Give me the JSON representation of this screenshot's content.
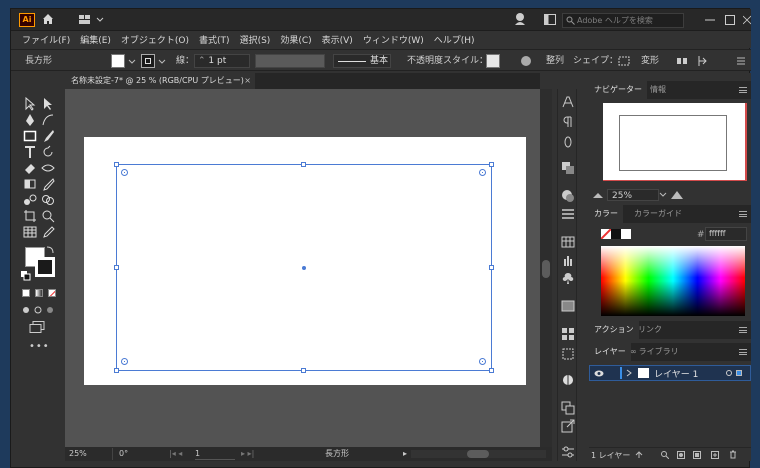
{
  "app": {
    "logo": "Ai",
    "search_placeholder": "Adobe ヘルプを検索"
  },
  "menu": [
    "ファイル(F)",
    "編集(E)",
    "オブジェクト(O)",
    "書式(T)",
    "選択(S)",
    "効果(C)",
    "表示(V)",
    "ウィンドウ(W)",
    "ヘルプ(H)"
  ],
  "control": {
    "object_type": "長方形",
    "stroke_label": "線：",
    "stroke_weight": "1 pt",
    "brush_label": "基本",
    "opacity_label": "不透明度",
    "style_label": "スタイル：",
    "align_label": "整列",
    "shape_label": "シェイプ：",
    "transform_label": "変形"
  },
  "document": {
    "tab_title": "名称未設定-7* @ 25 % (RGB/CPU プレビュー)",
    "close": "×"
  },
  "status": {
    "zoom": "25%",
    "rotation": "0°",
    "page": "1",
    "tool": "長方形"
  },
  "panels": {
    "navigator_tab": "ナビゲーター",
    "info_tab": "情報",
    "nav_zoom": "25%",
    "color_tab": "カラー",
    "color_guide_tab": "カラーガイド",
    "hex_prefix": "#",
    "hex_value": "ffffff",
    "actions_tab": "アクション",
    "links_tab": "リンク",
    "layers_tab": "レイヤー",
    "libraries_tab": "ライブラリ",
    "layer_name": "レイヤー 1",
    "layers_count": "1 レイヤー"
  },
  "colors": {
    "accent": "#4b7bd4",
    "panel": "#323232",
    "canvas": "#535353"
  }
}
